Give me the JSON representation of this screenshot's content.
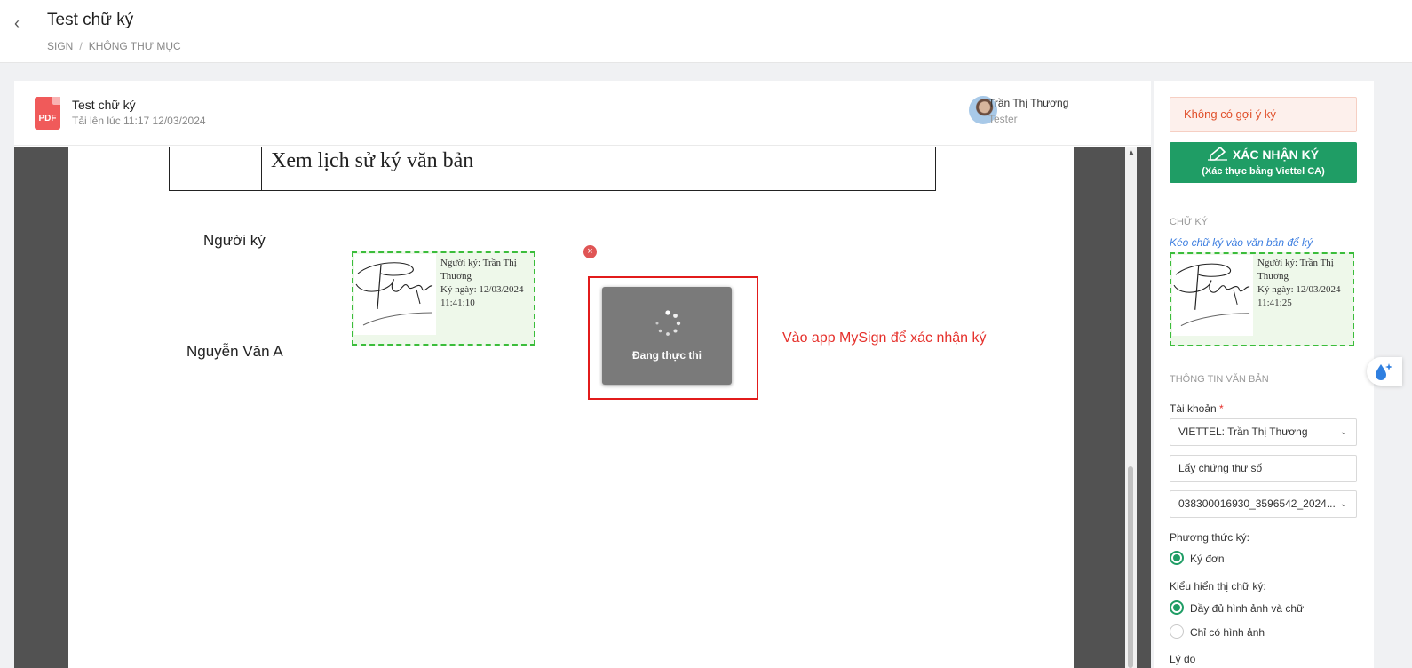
{
  "header": {
    "back_icon": "chevron-left-icon",
    "title": "Test chữ ký",
    "breadcrumb": [
      "SIGN",
      "KHÔNG THƯ MỤC"
    ],
    "breadcrumb_sep": "/"
  },
  "document": {
    "icon": "pdf-file-icon",
    "icon_label": "PDF",
    "name": "Test chữ ký",
    "uploaded": "Tải lên lúc 11:17 12/03/2024",
    "user": {
      "name": "Trần Thị Thương",
      "role": "Tester"
    }
  },
  "viewer": {
    "table_text": "Xem lịch sử ký văn bản",
    "signer_label": "Người ký",
    "signer_name": "Nguyễn Văn A",
    "placed_signature": {
      "lines": [
        "Người ký: Trần Thị",
        "Thương",
        "Ký ngày: 12/03/2024",
        "11:41:10"
      ]
    },
    "remove_icon": "close-icon",
    "loading_text": "Đang thực thi",
    "hint": "Vào app MySign để xác nhận ký"
  },
  "panel": {
    "alert": "Không có gợi ý ký",
    "confirm_label": "XÁC NHẬN KÝ",
    "confirm_sub": "(Xác thực bằng Viettel CA)",
    "signature_section": "CHỮ KÝ",
    "drag_hint": "Kéo chữ ký vào văn bản để ký",
    "preview_signature": {
      "lines": [
        "Người ký: Trần Thị",
        "Thương",
        "Ký ngày: 12/03/2024",
        "11:41:25"
      ]
    },
    "info_section": "THÔNG TIN VĂN BẢN",
    "account_label": "Tài khoản",
    "account_required": "*",
    "account_value": "VIETTEL: Trần Thị Thương",
    "get_cert_label": "Lấy chứng thư số",
    "cert_value": "038300016930_3596542_2024...",
    "method_label": "Phương thức ký:",
    "method_option": "Ký đơn",
    "display_label": "Kiểu hiển thị chữ ký:",
    "display_options": [
      "Đầy đủ hình ảnh và chữ",
      "Chỉ có hình ảnh"
    ],
    "reason_label": "Lý do"
  },
  "colors": {
    "primary": "#1f9d65",
    "alert_text": "#e0502b",
    "hint_red": "#e5302b",
    "dashed_green": "#3bbd3b"
  }
}
